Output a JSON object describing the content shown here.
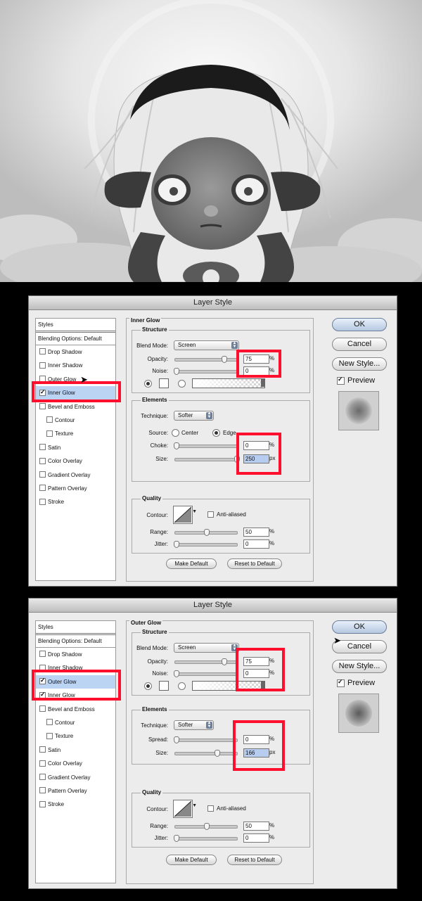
{
  "dialogs": [
    {
      "title": "Layer Style",
      "styles_panel": {
        "header": "Styles",
        "blending_options": "Blending Options: Default",
        "items": [
          {
            "label": "Drop Shadow",
            "checked": false,
            "sub": false
          },
          {
            "label": "Inner Shadow",
            "checked": false,
            "sub": false
          },
          {
            "label": "Outer Glow",
            "checked": false,
            "sub": false
          },
          {
            "label": "Inner Glow",
            "checked": true,
            "sub": false,
            "selected": true
          },
          {
            "label": "Bevel and Emboss",
            "checked": false,
            "sub": false
          },
          {
            "label": "Contour",
            "checked": false,
            "sub": true
          },
          {
            "label": "Texture",
            "checked": false,
            "sub": true
          },
          {
            "label": "Satin",
            "checked": false,
            "sub": false
          },
          {
            "label": "Color Overlay",
            "checked": false,
            "sub": false
          },
          {
            "label": "Gradient Overlay",
            "checked": false,
            "sub": false
          },
          {
            "label": "Pattern Overlay",
            "checked": false,
            "sub": false
          },
          {
            "label": "Stroke",
            "checked": false,
            "sub": false
          }
        ]
      },
      "section_title": "Inner Glow",
      "structure": {
        "title": "Structure",
        "blend_mode_label": "Blend Mode:",
        "blend_mode": "Screen",
        "opacity_label": "Opacity:",
        "opacity": "75",
        "opacity_unit": "%",
        "noise_label": "Noise:",
        "noise": "0",
        "noise_unit": "%"
      },
      "elements": {
        "title": "Elements",
        "technique_label": "Technique:",
        "technique": "Softer",
        "source_label": "Source:",
        "source_center": "Center",
        "source_edge": "Edge",
        "param1_label": "Choke:",
        "param1": "0",
        "param1_unit": "%",
        "size_label": "Size:",
        "size": "250",
        "size_unit": "px"
      },
      "quality": {
        "title": "Quality",
        "contour_label": "Contour:",
        "anti_aliased": "Anti-aliased",
        "range_label": "Range:",
        "range": "50",
        "range_unit": "%",
        "jitter_label": "Jitter:",
        "jitter": "0",
        "jitter_unit": "%"
      },
      "make_default": "Make Default",
      "reset_default": "Reset to Default",
      "buttons": {
        "ok": "OK",
        "cancel": "Cancel",
        "new_style": "New Style..."
      },
      "preview_label": "Preview"
    },
    {
      "title": "Layer Style",
      "styles_panel": {
        "header": "Styles",
        "blending_options": "Blending Options: Default",
        "items": [
          {
            "label": "Drop Shadow",
            "checked": false,
            "sub": false
          },
          {
            "label": "Inner Shadow",
            "checked": false,
            "sub": false
          },
          {
            "label": "Outer Glow",
            "checked": true,
            "sub": false,
            "selected": true
          },
          {
            "label": "Inner Glow",
            "checked": true,
            "sub": false
          },
          {
            "label": "Bevel and Emboss",
            "checked": false,
            "sub": false
          },
          {
            "label": "Contour",
            "checked": false,
            "sub": true
          },
          {
            "label": "Texture",
            "checked": false,
            "sub": true
          },
          {
            "label": "Satin",
            "checked": false,
            "sub": false
          },
          {
            "label": "Color Overlay",
            "checked": false,
            "sub": false
          },
          {
            "label": "Gradient Overlay",
            "checked": false,
            "sub": false
          },
          {
            "label": "Pattern Overlay",
            "checked": false,
            "sub": false
          },
          {
            "label": "Stroke",
            "checked": false,
            "sub": false
          }
        ]
      },
      "section_title": "Outer Glow",
      "structure": {
        "title": "Structure",
        "blend_mode_label": "Blend Mode:",
        "blend_mode": "Screen",
        "opacity_label": "Opacity:",
        "opacity": "75",
        "opacity_unit": "%",
        "noise_label": "Noise:",
        "noise": "0",
        "noise_unit": "%"
      },
      "elements": {
        "title": "Elements",
        "technique_label": "Technique:",
        "technique": "Softer",
        "param1_label": "Spread:",
        "param1": "0",
        "param1_unit": "%",
        "size_label": "Size:",
        "size": "166",
        "size_unit": "px"
      },
      "quality": {
        "title": "Quality",
        "contour_label": "Contour:",
        "anti_aliased": "Anti-aliased",
        "range_label": "Range:",
        "range": "50",
        "range_unit": "%",
        "jitter_label": "Jitter:",
        "jitter": "0",
        "jitter_unit": "%"
      },
      "make_default": "Make Default",
      "reset_default": "Reset to Default",
      "buttons": {
        "ok": "OK",
        "cancel": "Cancel",
        "new_style": "New Style..."
      },
      "preview_label": "Preview"
    }
  ],
  "colors": {
    "highlight_red": "#ff0f2e",
    "selection_blue": "#bcd4f4",
    "dialog_bg": "#ececec"
  }
}
